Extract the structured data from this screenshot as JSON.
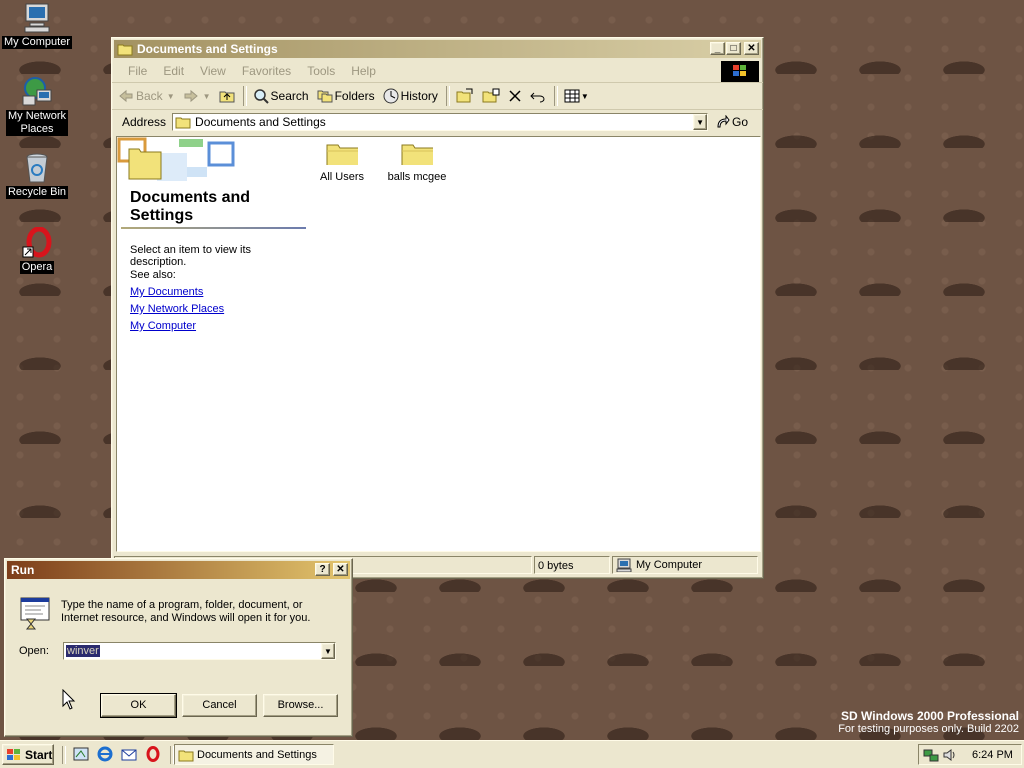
{
  "desktop": {
    "icons": [
      {
        "label": "My Computer"
      },
      {
        "label_line1": "My Network",
        "label_line2": "Places"
      },
      {
        "label": "Recycle Bin"
      },
      {
        "label": "Opera"
      }
    ],
    "watermark": {
      "line1": "SD Windows 2000 Professional",
      "line2": "For testing purposes only. Build 2202"
    }
  },
  "explorer": {
    "title": "Documents and Settings",
    "menu": [
      "File",
      "Edit",
      "View",
      "Favorites",
      "Tools",
      "Help"
    ],
    "toolbar": {
      "back": "Back",
      "search": "Search",
      "folders": "Folders",
      "history": "History"
    },
    "address": {
      "label": "Address",
      "value": "Documents and Settings",
      "go": "Go"
    },
    "webview": {
      "title_line1": "Documents and",
      "title_line2": "Settings",
      "description": "Select an item to view its description.",
      "see_also": "See also:",
      "links": [
        "My Documents",
        "My Network Places",
        "My Computer"
      ]
    },
    "items": [
      "All Users",
      "balls mcgee"
    ],
    "status": {
      "size": "0 bytes",
      "zone": "My Computer"
    }
  },
  "run_dialog": {
    "title": "Run",
    "text_line1": "Type the name of a program, folder, document, or",
    "text_line2": "Internet resource, and Windows will open it for you.",
    "open_label": "Open:",
    "open_value": "winver",
    "ok": "OK",
    "cancel": "Cancel",
    "browse": "Browse..."
  },
  "taskbar": {
    "start": "Start",
    "task": "Documents and Settings",
    "clock": "6:24 PM"
  }
}
